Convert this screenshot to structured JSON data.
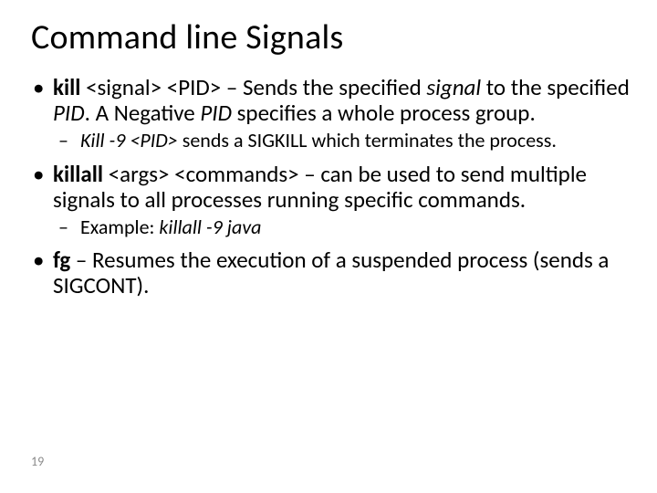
{
  "title": "Command line Signals",
  "bullets": {
    "b1": {
      "cmd": "kill",
      "args": " <signal> <PID> ",
      "sep": " – ",
      "t1": "Sends the specified ",
      "sig": "signal",
      "t2": " to the specified ",
      "pid": "PID",
      "t3": ". A  Negative ",
      "pid2": "PID",
      "t4": "  specifies a whole process group.",
      "sub": {
        "lead": "Kill -9 <PID>",
        "rest": " sends a SIGKILL which terminates the process."
      }
    },
    "b2": {
      "cmd": "killall",
      "args": " <args> <commands> – can be used to send multiple signals to all processes running specific commands.",
      "sub": {
        "lead": "Example: ",
        "cmd": "killall -9 java"
      }
    },
    "b3": {
      "cmd": "fg",
      "rest": " – Resumes the execution of a suspended process (sends a SIGCONT)."
    }
  },
  "page_number": "19"
}
